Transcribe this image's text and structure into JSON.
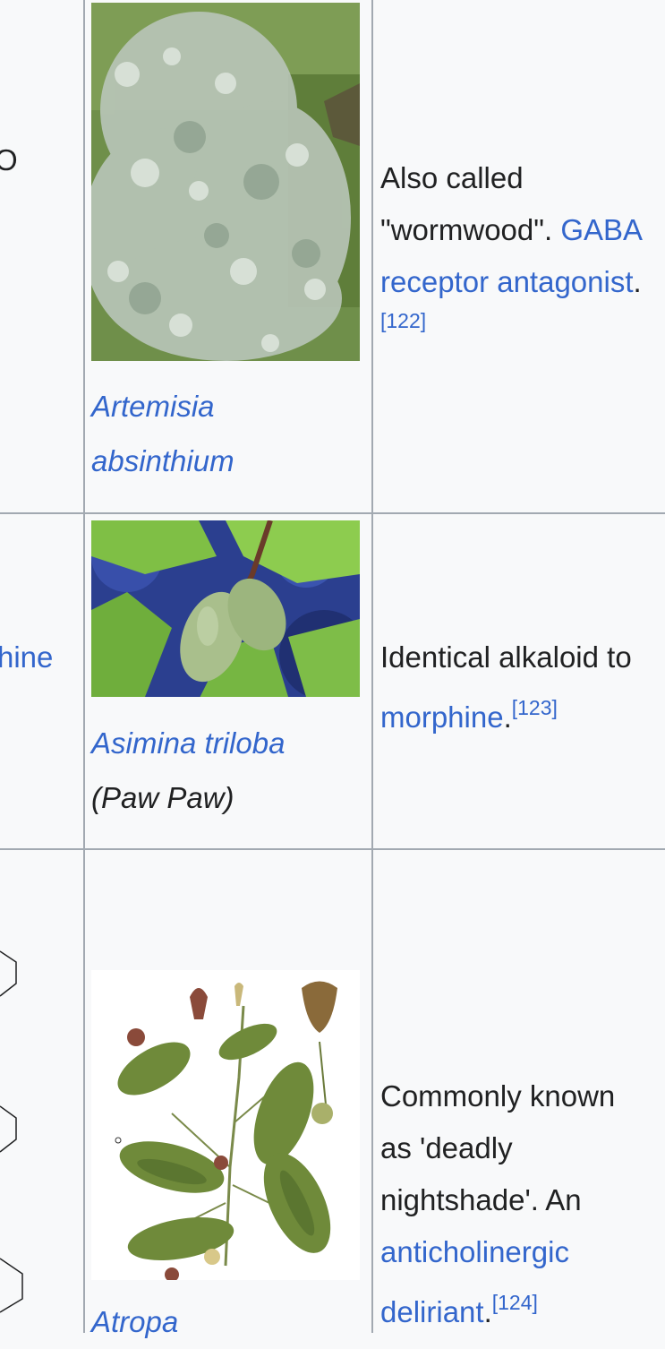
{
  "rows": [
    {
      "left_fragment": "O",
      "image_name": "artemisia-absinthium-photo",
      "caption_line1": "Artemisia",
      "caption_line2": "absinthium",
      "desc_line1": "Also called",
      "desc_line2_text": "\"wormwood\". ",
      "desc_link1": "GABA",
      "desc_link2": "receptor antagonist",
      "desc_after": ".",
      "ref": "[122]"
    },
    {
      "left_fragment": "hine",
      "image_name": "asimina-triloba-photo",
      "caption_line1": "Asimina triloba",
      "caption_note": "(Paw Paw)",
      "desc_line1": "Identical alkaloid to",
      "desc_link": "morphine",
      "desc_after": ".",
      "ref": "[123]"
    },
    {
      "image_name": "atropa-belladonna-illustration",
      "caption_line1": "Atropa",
      "desc_line1": "Commonly known",
      "desc_line2": "as 'deadly",
      "desc_line3": "nightshade'. An",
      "desc_link1": "anticholinergic",
      "desc_link2": "deliriant",
      "desc_after": ".",
      "ref": "[124]"
    }
  ],
  "colors": {
    "link": "#3366cc",
    "text": "#202122",
    "border": "#a2a9b1",
    "background": "#f8f9fa"
  }
}
